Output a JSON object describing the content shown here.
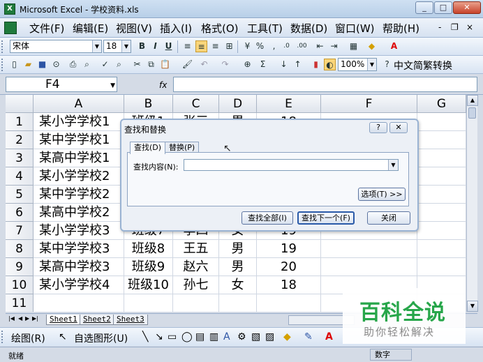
{
  "window": {
    "title": "Microsoft Excel - 学校资料.xls",
    "min": "_",
    "max": "□",
    "close": "✕"
  },
  "menu": {
    "items": [
      "文件(F)",
      "编辑(E)",
      "视图(V)",
      "插入(I)",
      "格式(O)",
      "工具(T)",
      "数据(D)",
      "窗口(W)",
      "帮助(H)"
    ],
    "right_min": "-",
    "right_restore": "❐",
    "right_close": "×"
  },
  "format_toolbar": {
    "font": "宋体",
    "size": "18",
    "bold": "B",
    "italic": "I",
    "underline": "U",
    "percent": "%"
  },
  "standard_toolbar": {
    "zoom": "100%",
    "sigma": "Σ",
    "convert": "中文简繁转换"
  },
  "formula_bar": {
    "name_box": "F4",
    "fx": "fx",
    "value": ""
  },
  "columns": [
    "A",
    "B",
    "C",
    "D",
    "E",
    "F",
    "G"
  ],
  "rows": [
    {
      "n": "1",
      "A": "某小学学校1",
      "B": "班级1",
      "C": "张三",
      "D": "男",
      "E": "18"
    },
    {
      "n": "2",
      "A": "某中学学校1",
      "B": "",
      "C": "",
      "D": "",
      "E": ""
    },
    {
      "n": "3",
      "A": "某高中学校1",
      "B": "",
      "C": "",
      "D": "",
      "E": ""
    },
    {
      "n": "4",
      "A": "某小学学校2",
      "B": "",
      "C": "",
      "D": "",
      "E": ""
    },
    {
      "n": "5",
      "A": "某中学学校2",
      "B": "",
      "C": "",
      "D": "",
      "E": ""
    },
    {
      "n": "6",
      "A": "某高中学校2",
      "B": "",
      "C": "",
      "D": "",
      "E": ""
    },
    {
      "n": "7",
      "A": "某小学学校3",
      "B": "班级7",
      "C": "李四",
      "D": "女",
      "E": "19"
    },
    {
      "n": "8",
      "A": "某中学学校3",
      "B": "班级8",
      "C": "王五",
      "D": "男",
      "E": "19"
    },
    {
      "n": "9",
      "A": "某高中学校3",
      "B": "班级9",
      "C": "赵六",
      "D": "男",
      "E": "20"
    },
    {
      "n": "10",
      "A": "某小学学校4",
      "B": "班级10",
      "C": "孙七",
      "D": "女",
      "E": "18"
    },
    {
      "n": "11",
      "A": "",
      "B": "",
      "C": "",
      "D": "",
      "E": ""
    }
  ],
  "sheets": [
    "Sheet1",
    "Sheet2",
    "Sheet3"
  ],
  "draw_toolbar": {
    "draw": "绘图(R)",
    "autoshape": "自选图形(U)"
  },
  "status": {
    "text": "就绪",
    "num": "数字"
  },
  "dialog": {
    "title": "查找和替换",
    "help": "?",
    "close": "✕",
    "tab_find": "查找(D)",
    "tab_replace": "替换(P)",
    "find_label": "查找内容(N):",
    "find_value": "",
    "options_btn": "选项(T) >>",
    "find_all_btn": "查找全部(I)",
    "find_next_btn": "查找下一个(F)",
    "close_btn": "关闭"
  },
  "watermark": {
    "title": "百科全说",
    "subtitle": "助你轻松解决"
  }
}
